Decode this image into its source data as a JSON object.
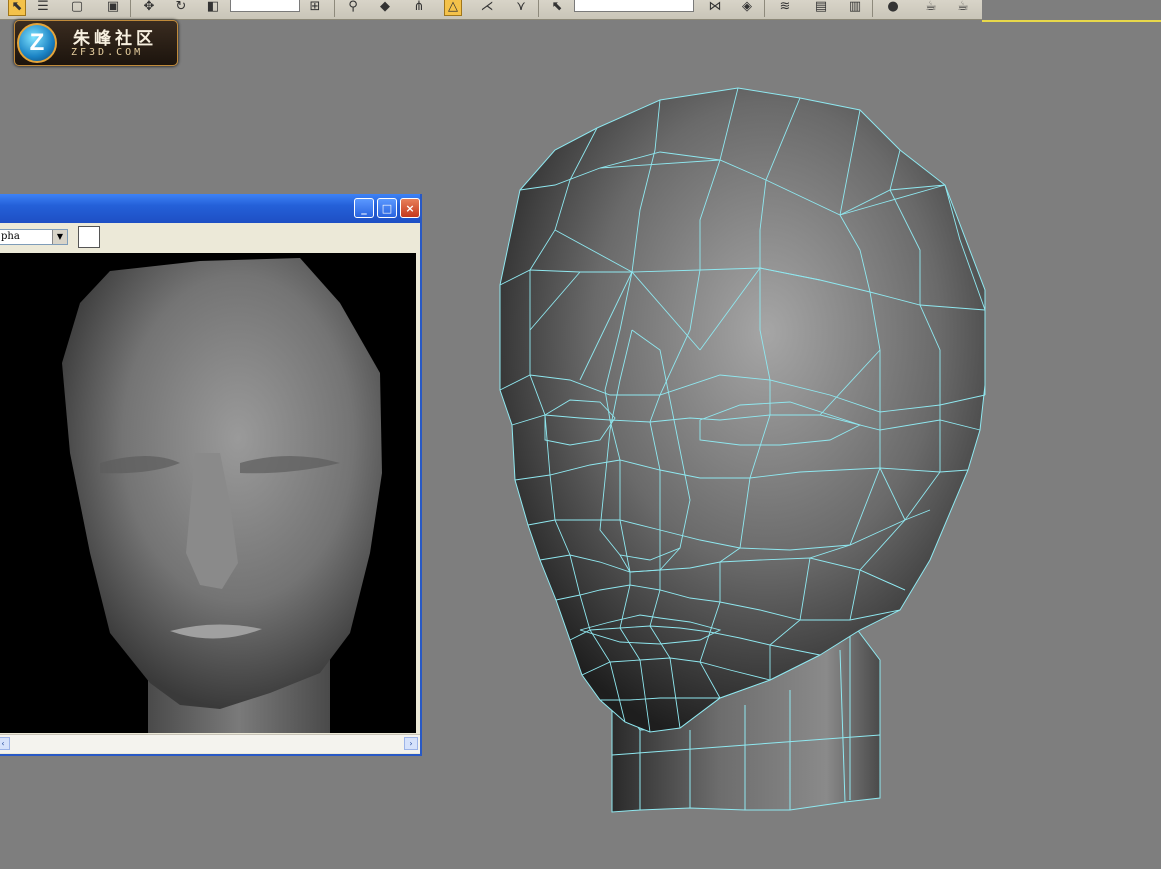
{
  "toolbar": {
    "combo_left": "",
    "combo_right": ""
  },
  "logo": {
    "badge": "Z",
    "title": "朱峰社区",
    "subtitle": "ZF3D.COM"
  },
  "render_window": {
    "channel_select": "pha",
    "select_arrow": "▼",
    "minimize": "_",
    "maximize": "□",
    "close": "×",
    "scroll_right": "›",
    "scroll_left": "‹"
  },
  "viewport": {
    "wire_color": "#8fe8f0",
    "background": "#7e7e7e"
  }
}
